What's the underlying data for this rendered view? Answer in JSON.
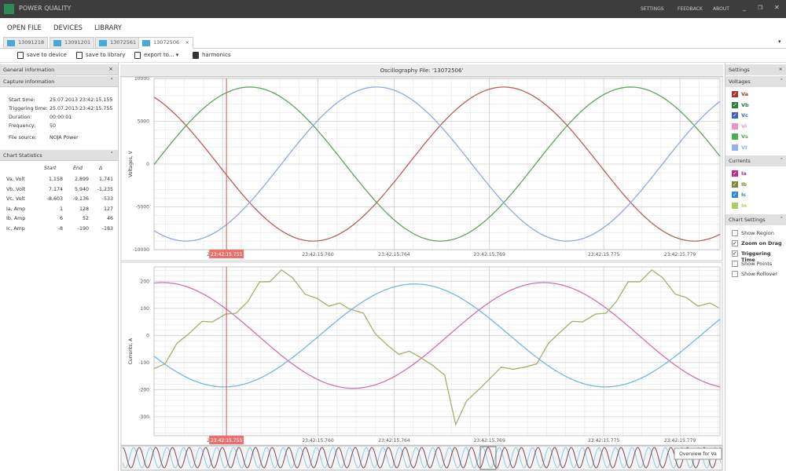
{
  "app": {
    "title": "POWER QUALITY",
    "links": [
      "SETTINGS",
      "FEEDBACK",
      "ABOUT"
    ],
    "window_controls": [
      "minimize-icon",
      "restore-icon",
      "close-icon"
    ]
  },
  "menu": [
    "OPEN FILE",
    "DEVICES",
    "LIBRARY"
  ],
  "tabs": [
    {
      "label": "13091218"
    },
    {
      "label": "13091201"
    },
    {
      "label": "13072561"
    },
    {
      "label": "13072506",
      "active": true
    }
  ],
  "toolbar": {
    "save_device": "save to device",
    "save_library": "save to library",
    "export": "export to...",
    "harmonics": "harmonics"
  },
  "left": {
    "general": "General information",
    "capture": "Capture information",
    "fields": [
      [
        "Start time:",
        "25.07.2013 23:42:15.155"
      ],
      [
        "Triggering time:",
        "25.07.2013 23:42:15.755"
      ],
      [
        "Duration:",
        "00:00:01"
      ],
      [
        "Frequency:",
        "50"
      ],
      [
        "File source:",
        "NOJA Power"
      ]
    ],
    "stats_title": "Chart Statistics",
    "stats_headers": [
      "Start",
      "End",
      "Δ"
    ],
    "stats": [
      [
        "Va, Volt",
        "1,158",
        "2,899",
        "1,741"
      ],
      [
        "Vb, Volt",
        "7,174",
        "5,940",
        "-1,235"
      ],
      [
        "Vc, Volt",
        "-8,603",
        "-9,136",
        "-533"
      ],
      [
        "Ia, Amp",
        "1",
        "128",
        "127"
      ],
      [
        "Ib, Amp",
        "6",
        "52",
        "46"
      ],
      [
        "Ic, Amp",
        "-8",
        "-190",
        "-183"
      ]
    ]
  },
  "right": {
    "settings": "Settings",
    "voltages_title": "Voltages",
    "voltages": [
      {
        "label": "Va",
        "color": "#a83232",
        "checked": true
      },
      {
        "label": "Vb",
        "color": "#2e7d32",
        "checked": true
      },
      {
        "label": "Vc",
        "color": "#3a5fcd",
        "checked": true
      },
      {
        "label": "Vi",
        "color": "#f090c8",
        "checked": false
      },
      {
        "label": "Vs",
        "color": "#4caf50",
        "checked": false
      },
      {
        "label": "Vt",
        "color": "#90b0f0",
        "checked": false
      }
    ],
    "currents_title": "Currents",
    "currents": [
      {
        "label": "Ia",
        "color": "#c0288a",
        "checked": true
      },
      {
        "label": "Ib",
        "color": "#7a8a30",
        "checked": true
      },
      {
        "label": "Ic",
        "color": "#2a8ad8",
        "checked": true
      },
      {
        "label": "In",
        "color": "#a8d060",
        "checked": false
      }
    ],
    "chart_settings_title": "Chart Settings",
    "chart_settings": [
      {
        "label": "Show Region",
        "checked": false
      },
      {
        "label": "Zoom on Drag",
        "checked": true
      },
      {
        "label": "Triggering Time",
        "checked": true
      },
      {
        "label": "Show Points",
        "checked": false
      },
      {
        "label": "Show Rollover",
        "checked": false
      }
    ]
  },
  "chart_title": "Oscillography File: '13072506'",
  "overview_label": "Overview for Va",
  "cursor_label": "23:42:15.755",
  "chart_data": [
    {
      "type": "line",
      "ylabel": "Voltages, V",
      "ylim": [
        -10000,
        10000
      ],
      "yticks": [
        10000,
        5000,
        0,
        -5000,
        -10000
      ],
      "xlim": [
        15.7514,
        15.7811
      ],
      "xticks": [
        15.755,
        15.76,
        15.764,
        15.769,
        15.775,
        15.779
      ],
      "xtick_labels": [
        "23:42:15.755",
        "23:42:15.760",
        "23:42:15.764",
        "23:42:15.769",
        "23:42:15.775",
        "23:42:15.779"
      ],
      "grid": true,
      "cursor_x": 15.7552,
      "series": [
        {
          "name": "Va",
          "color": "#b5605a",
          "sine": {
            "amplitude": 9000,
            "frequency_hz": 50,
            "peak_time": 15.76975
          }
        },
        {
          "name": "Vb",
          "color": "#5fa35f",
          "sine": {
            "amplitude": 9000,
            "frequency_hz": 50,
            "peak_time": 15.75642
          }
        },
        {
          "name": "Vc",
          "color": "#8fa8e0",
          "sine": {
            "amplitude": 9000,
            "frequency_hz": 50,
            "peak_time": 15.76308
          }
        }
      ]
    },
    {
      "type": "line",
      "ylabel": "Currents, A",
      "ylim": [
        -370,
        253
      ],
      "yticks": [
        200,
        100,
        0,
        -100,
        -200,
        -300
      ],
      "xlim": [
        15.7514,
        15.7811
      ],
      "xticks": [
        15.755,
        15.76,
        15.764,
        15.769,
        15.775,
        15.779
      ],
      "xtick_labels": [
        "23:42:15.755",
        "23:42:15.760",
        "23:42:15.764",
        "23:42:15.769",
        "23:42:15.775",
        "23:42:15.779"
      ],
      "grid": true,
      "cursor_x": 15.7552,
      "series": [
        {
          "name": "Ia",
          "color": "#d070b0",
          "sine": {
            "amplitude": 195,
            "frequency_hz": 50,
            "peak_time": 15.75185
          }
        },
        {
          "name": "Ic",
          "color": "#70b8e8",
          "sine": {
            "amplitude": 190,
            "frequency_hz": 50,
            "peak_time": 15.76508
          }
        },
        {
          "name": "Ib",
          "color": "#a0b070",
          "points": [
            [
              15.75115,
              -122
            ],
            [
              15.75198,
              -105
            ],
            [
              15.7526,
              -29
            ],
            [
              15.75322,
              6
            ],
            [
              15.75392,
              52
            ],
            [
              15.75446,
              50
            ],
            [
              15.75516,
              79
            ],
            [
              15.7557,
              82
            ],
            [
              15.75632,
              125
            ],
            [
              15.75694,
              198
            ],
            [
              15.75747,
              198
            ],
            [
              15.75809,
              242
            ],
            [
              15.75867,
              213
            ],
            [
              15.75933,
              152
            ],
            [
              15.75995,
              137
            ],
            [
              15.76057,
              108
            ],
            [
              15.76115,
              120
            ],
            [
              15.76161,
              99
            ],
            [
              15.76239,
              82
            ],
            [
              15.76301,
              6
            ],
            [
              15.76363,
              -35
            ],
            [
              15.76425,
              -70
            ],
            [
              15.76479,
              -58
            ],
            [
              15.76533,
              -79
            ],
            [
              15.76603,
              -111
            ],
            [
              15.76665,
              -146
            ],
            [
              15.76723,
              -329
            ],
            [
              15.7678,
              -242
            ],
            [
              15.76851,
              -195
            ],
            [
              15.76962,
              -117
            ],
            [
              15.77024,
              -125
            ],
            [
              15.77086,
              -117
            ],
            [
              15.77148,
              -105
            ],
            [
              15.7721,
              -29
            ],
            [
              15.77276,
              15
            ],
            [
              15.77334,
              52
            ],
            [
              15.77388,
              50
            ],
            [
              15.77458,
              79
            ],
            [
              15.77512,
              82
            ],
            [
              15.77566,
              125
            ],
            [
              15.77628,
              198
            ],
            [
              15.7769,
              198
            ],
            [
              15.77752,
              242
            ],
            [
              15.77809,
              213
            ],
            [
              15.77876,
              152
            ],
            [
              15.77933,
              140
            ],
            [
              15.77995,
              108
            ],
            [
              15.78057,
              120
            ],
            [
              15.78103,
              102
            ]
          ]
        }
      ]
    }
  ]
}
